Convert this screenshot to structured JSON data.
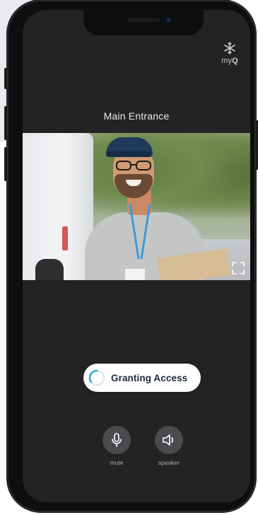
{
  "app": {
    "logo_text_prefix": "my",
    "logo_text_suffix": "Q",
    "logo_icon": "snowflake-icon"
  },
  "door": {
    "title": "Main Entrance"
  },
  "video": {
    "fullscreen_icon": "fullscreen-icon"
  },
  "status": {
    "label": "Granting Access",
    "accent": "#2aa9e0"
  },
  "controls": [
    {
      "label": "mute",
      "icon": "microphone-icon"
    },
    {
      "label": "speaker",
      "icon": "speaker-icon"
    }
  ]
}
